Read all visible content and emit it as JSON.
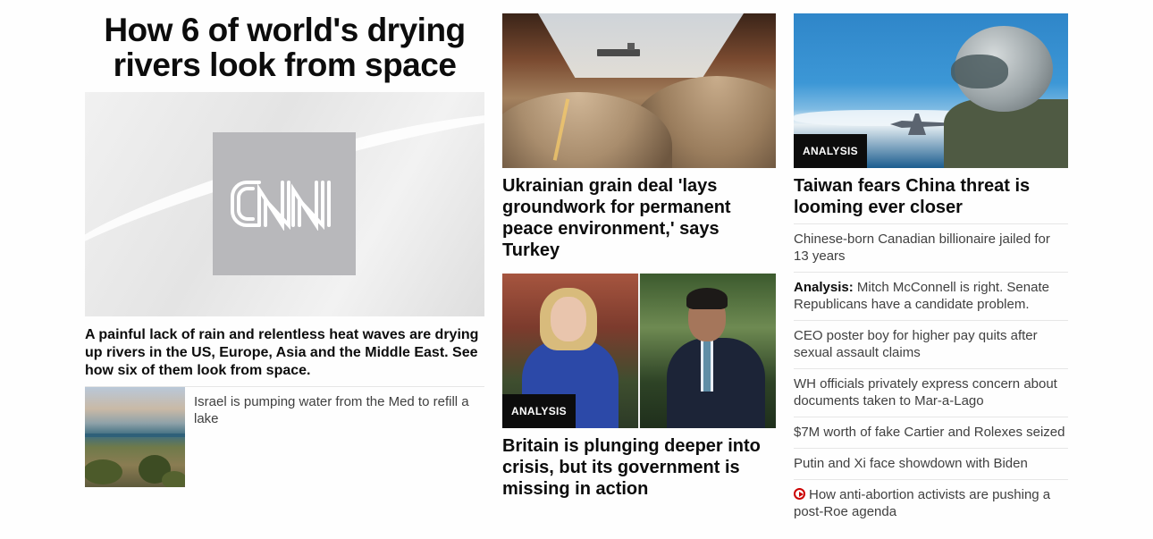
{
  "lead": {
    "headline": "How 6 of world's drying rivers look from space",
    "image_logo": "CNN",
    "summary": "A painful lack of rain and relentless heat waves are drying up rivers in the US, Europe, Asia and the Middle East. See how six of them look from space.",
    "related": "Israel is pumping water from the Med to refill a lake"
  },
  "middle": {
    "story1": {
      "headline": "Ukrainian grain deal 'lays groundwork for permanent peace environment,' says Turkey"
    },
    "story2": {
      "badge": "ANALYSIS",
      "headline": "Britain is plunging deeper into crisis, but its government is missing in action"
    }
  },
  "right": {
    "top": {
      "badge": "ANALYSIS",
      "headline": "Taiwan fears China threat is looming ever closer"
    },
    "items": [
      {
        "prefix": "",
        "text": "Chinese-born Canadian billionaire jailed for 13 years"
      },
      {
        "prefix": "Analysis:",
        "text": " Mitch McConnell is right. Senate Republicans have a candidate problem."
      },
      {
        "prefix": "",
        "text": "CEO poster boy for higher pay quits after sexual assault claims"
      },
      {
        "prefix": "",
        "text": "WH officials privately express concern about documents taken to Mar-a-Lago"
      },
      {
        "prefix": "",
        "text": "$7M worth of fake Cartier and Rolexes seized"
      },
      {
        "prefix": "",
        "text": "Putin and Xi face showdown with Biden"
      },
      {
        "prefix": "",
        "text": "How anti-abortion activists are pushing a post-Roe agenda",
        "icon": "play-video-icon"
      }
    ]
  },
  "colors": {
    "accent_red": "#cc0000",
    "badge_bg": "#0c0c0c",
    "text": "#0c0c0c",
    "secondary_text": "#404040"
  }
}
